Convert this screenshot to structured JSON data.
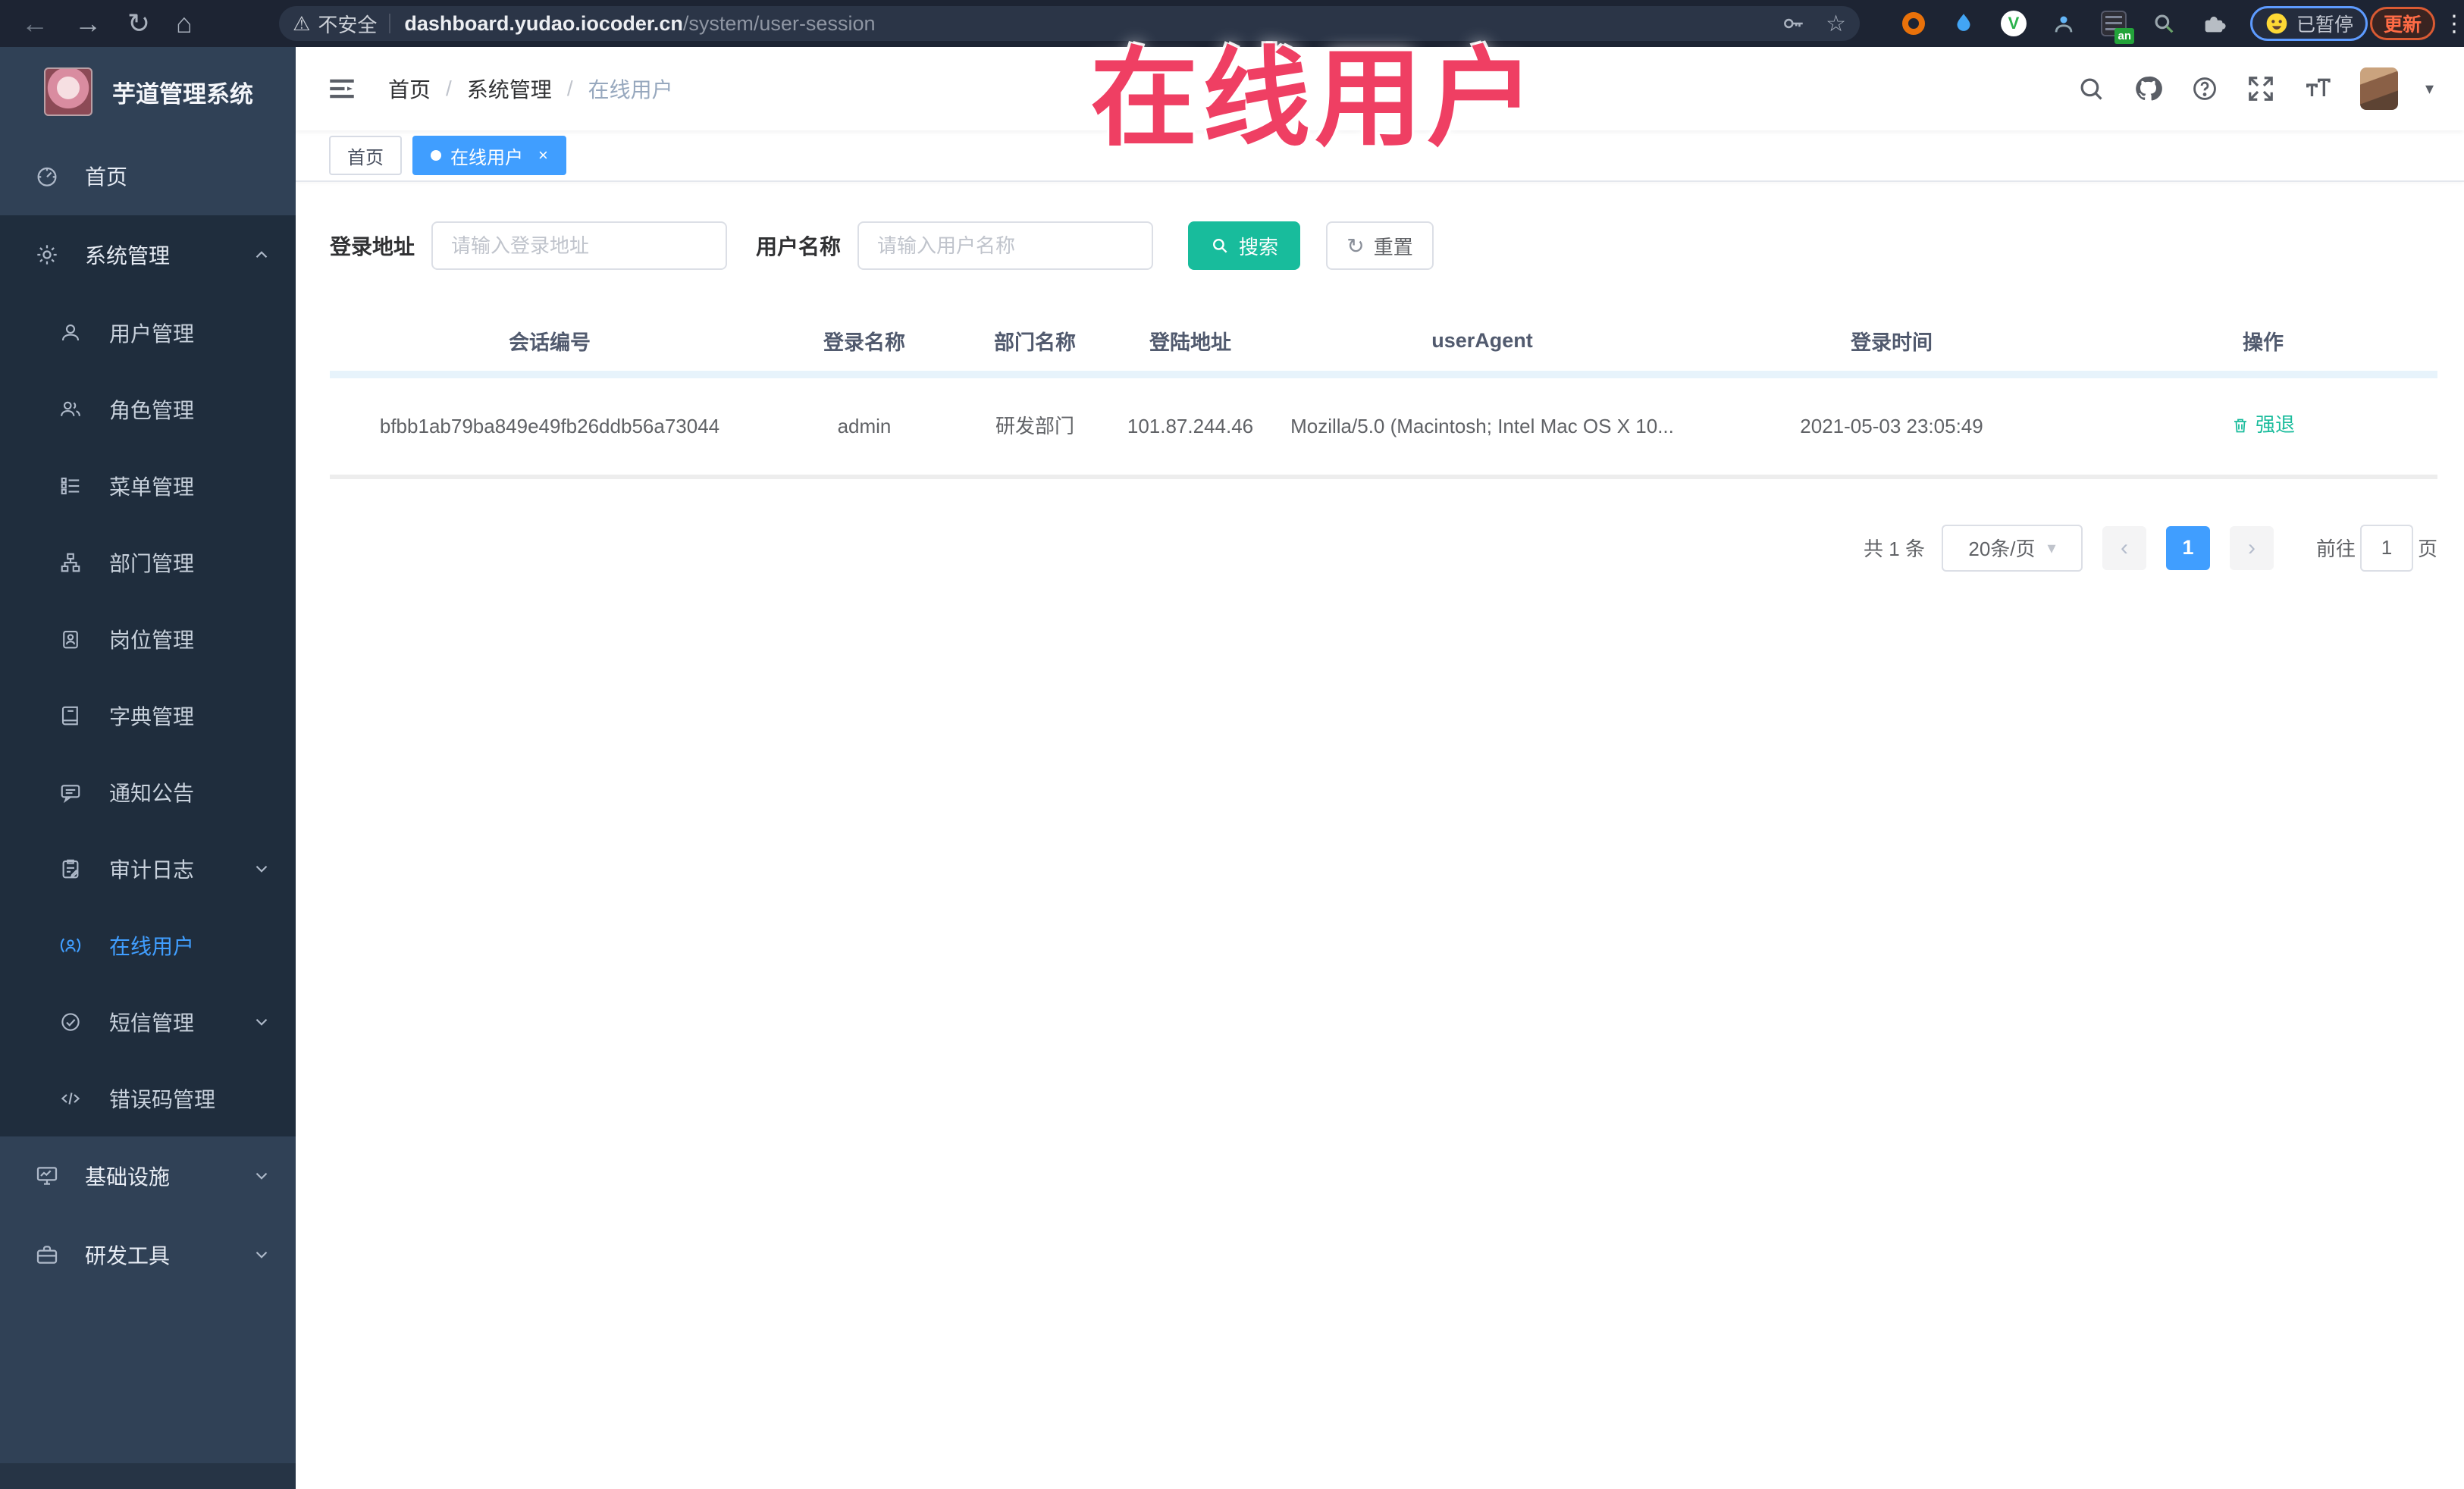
{
  "browser": {
    "security_warning": "不安全",
    "url_host": "dashboard.yudao.iocoder.cn",
    "url_path": "/system/user-session",
    "paused_badge_label": "已暂停",
    "update_button_label": "更新",
    "extension_badge": "an"
  },
  "overlay_title": "在线用户",
  "icons": {
    "back_icon": "←",
    "forward_icon": "→",
    "reload_icon": "↻",
    "home_icon": "⌂",
    "warning_icon": "⚠",
    "star_icon": "☆",
    "menu_dots_icon": "⋮",
    "refresh_icon": "↻",
    "caret_down_icon": "▾",
    "prev_icon": "‹",
    "next_icon": "›",
    "close_icon": "×"
  },
  "sidebar": {
    "logo_title": "芋道管理系统",
    "items": [
      {
        "label": "首页",
        "level": "root",
        "icon": "dashboard-icon",
        "active": false
      },
      {
        "label": "系统管理",
        "level": "root-open",
        "icon": "gear-icon",
        "chevron": "up"
      },
      {
        "label": "用户管理",
        "level": "child",
        "icon": "user-icon"
      },
      {
        "label": "角色管理",
        "level": "child",
        "icon": "role-icon"
      },
      {
        "label": "菜单管理",
        "level": "child",
        "icon": "menu-list-icon"
      },
      {
        "label": "部门管理",
        "level": "child",
        "icon": "org-tree-icon"
      },
      {
        "label": "岗位管理",
        "level": "child",
        "icon": "post-badge-icon"
      },
      {
        "label": "字典管理",
        "level": "child",
        "icon": "dictionary-icon"
      },
      {
        "label": "通知公告",
        "level": "child",
        "icon": "announcement-icon"
      },
      {
        "label": "审计日志",
        "level": "child",
        "icon": "audit-log-icon",
        "chevron": "down"
      },
      {
        "label": "在线用户",
        "level": "child",
        "icon": "online-user-icon",
        "active": true
      },
      {
        "label": "短信管理",
        "level": "child",
        "icon": "sms-icon",
        "chevron": "down"
      },
      {
        "label": "错误码管理",
        "level": "child",
        "icon": "error-code-icon"
      },
      {
        "label": "基础设施",
        "level": "root",
        "icon": "infrastructure-icon",
        "chevron": "down"
      },
      {
        "label": "研发工具",
        "level": "root",
        "icon": "devtools-icon",
        "chevron": "down"
      }
    ]
  },
  "header": {
    "breadcrumb": [
      "首页",
      "系统管理",
      "在线用户"
    ],
    "breadcrumb_separator": "/"
  },
  "tags": [
    {
      "label": "首页",
      "active": false
    },
    {
      "label": "在线用户",
      "active": true
    }
  ],
  "filters": {
    "login_address_label": "登录地址",
    "login_address_placeholder": "请输入登录地址",
    "username_label": "用户名称",
    "username_placeholder": "请输入用户名称",
    "search_button_label": "搜索",
    "reset_button_label": "重置"
  },
  "table": {
    "columns": [
      "会话编号",
      "登录名称",
      "部门名称",
      "登陆地址",
      "userAgent",
      "登录时间",
      "操作"
    ],
    "rows": [
      {
        "session_id": "bfbb1ab79ba849e49fb26ddb56a73044",
        "login_name": "admin",
        "dept_name": "研发部门",
        "login_ip": "101.87.244.46",
        "user_agent": "Mozilla/5.0 (Macintosh; Intel Mac OS X 10...",
        "login_time": "2021-05-03 23:05:49",
        "action_label": "强退"
      }
    ]
  },
  "pagination": {
    "total_text": "共 1 条",
    "page_size_text": "20条/页",
    "current_page": "1",
    "goto_label": "前往",
    "goto_value": "1",
    "goto_suffix": "页"
  },
  "colors": {
    "accent_blue": "#409EFF",
    "search_teal": "#18BC9C",
    "action_green": "#1ABC9C",
    "sidebar_bg": "#304156",
    "sidebar_submenu_bg": "#1F2D3D",
    "browser_bar_bg": "#1D2433",
    "overlay_red": "#EF3F63"
  }
}
